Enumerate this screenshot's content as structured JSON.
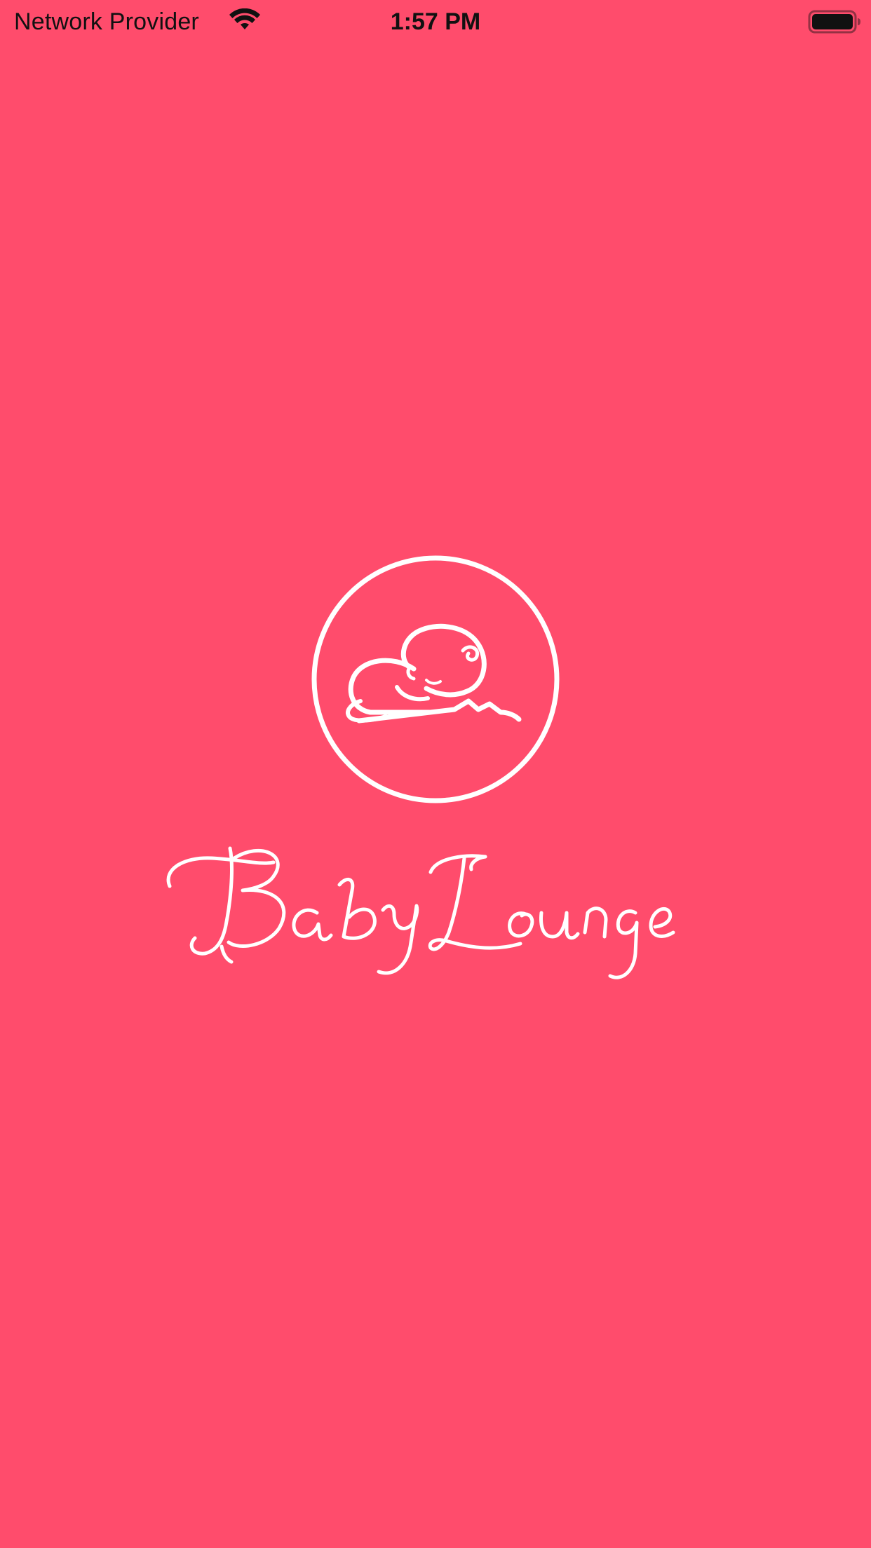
{
  "app": {
    "brand_name": "BabyLounge",
    "background_color": "#FF4C6C",
    "logo_color": "#FFFFFF"
  },
  "status_bar": {
    "carrier": "Network Provider",
    "time": "1:57 PM",
    "wifi_icon": "wifi-icon",
    "battery_icon": "battery-full-icon"
  }
}
